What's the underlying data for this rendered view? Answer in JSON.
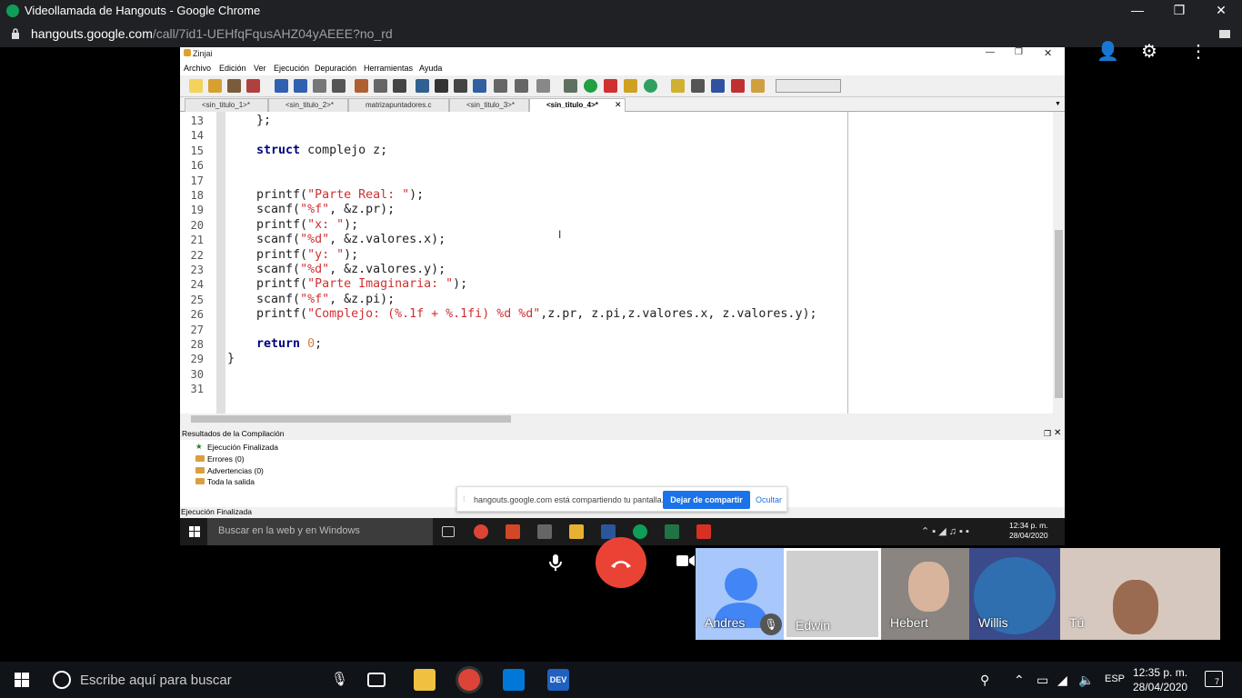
{
  "chrome": {
    "title": "Videollamada de Hangouts - Google Chrome",
    "url_host": "hangouts.google.com",
    "url_path": "/call/7id1-UEHfqFqusAHZ04yAEEE?no_rd",
    "minimize": "—",
    "restore": "❐",
    "close": "✕"
  },
  "zinjai": {
    "title": "Zinjai",
    "menu": [
      "Archivo",
      "Edición",
      "Ver",
      "Ejecución",
      "Depuración",
      "Herramientas",
      "Ayuda"
    ],
    "tabs": [
      "<sin_titulo_1>*",
      "<sin_titulo_2>*",
      "matrizapuntadores.c",
      "<sin_titulo_3>*",
      "<sin_titulo_4>*"
    ],
    "active_tab": 4,
    "tab_close": "✕",
    "line_numbers": [
      "13",
      "14",
      "15",
      "16",
      "17",
      "18",
      "19",
      "20",
      "21",
      "22",
      "23",
      "24",
      "25",
      "26",
      "27",
      "28",
      "29",
      "30",
      "31"
    ],
    "code_lines": [
      [
        {
          "t": "    };",
          "c": ""
        }
      ],
      [
        {
          "t": "",
          "c": ""
        }
      ],
      [
        {
          "t": "    ",
          "c": ""
        },
        {
          "t": "struct",
          "c": "kw"
        },
        {
          "t": " complejo z;",
          "c": ""
        }
      ],
      [
        {
          "t": "",
          "c": ""
        }
      ],
      [
        {
          "t": "",
          "c": ""
        }
      ],
      [
        {
          "t": "    printf(",
          "c": ""
        },
        {
          "t": "\"Parte Real: \"",
          "c": "str"
        },
        {
          "t": ");",
          "c": ""
        }
      ],
      [
        {
          "t": "    scanf(",
          "c": ""
        },
        {
          "t": "\"%f\"",
          "c": "str"
        },
        {
          "t": ", &z.pr);",
          "c": ""
        }
      ],
      [
        {
          "t": "    printf(",
          "c": ""
        },
        {
          "t": "\"x: \"",
          "c": "str"
        },
        {
          "t": ");",
          "c": ""
        }
      ],
      [
        {
          "t": "    scanf(",
          "c": ""
        },
        {
          "t": "\"%d\"",
          "c": "str"
        },
        {
          "t": ", &z.valores.x);",
          "c": ""
        }
      ],
      [
        {
          "t": "    printf(",
          "c": ""
        },
        {
          "t": "\"y: \"",
          "c": "str"
        },
        {
          "t": ");",
          "c": ""
        }
      ],
      [
        {
          "t": "    scanf(",
          "c": ""
        },
        {
          "t": "\"%d\"",
          "c": "str"
        },
        {
          "t": ", &z.valores.y);",
          "c": ""
        }
      ],
      [
        {
          "t": "    printf(",
          "c": ""
        },
        {
          "t": "\"Parte Imaginaria: \"",
          "c": "str"
        },
        {
          "t": ");",
          "c": ""
        }
      ],
      [
        {
          "t": "    scanf(",
          "c": ""
        },
        {
          "t": "\"%f\"",
          "c": "str"
        },
        {
          "t": ", &z.pi);",
          "c": ""
        }
      ],
      [
        {
          "t": "    printf(",
          "c": ""
        },
        {
          "t": "\"Complejo: (%.1f + %.1fi) %d %d\"",
          "c": "str"
        },
        {
          "t": ",z.pr, z.pi,z.valores.x, z.valores.y);",
          "c": ""
        }
      ],
      [
        {
          "t": "",
          "c": ""
        }
      ],
      [
        {
          "t": "    ",
          "c": ""
        },
        {
          "t": "return",
          "c": "kw"
        },
        {
          "t": " ",
          "c": ""
        },
        {
          "t": "0",
          "c": "num"
        },
        {
          "t": ";",
          "c": ""
        }
      ],
      [
        {
          "t": "}",
          "c": ""
        }
      ],
      [
        {
          "t": "",
          "c": ""
        }
      ],
      [
        {
          "t": "",
          "c": ""
        }
      ]
    ],
    "results_header": "Resultados de la Compilación",
    "results": [
      "Ejecución Finalizada",
      "Errores (0)",
      "Advertencias (0)",
      "Toda la salida"
    ],
    "status": "Ejecución Finalizada"
  },
  "share_notice": {
    "message": "hangouts.google.com está compartiendo tu pantalla.",
    "stop_button": "Dejar de compartir",
    "hide_button": "Ocultar"
  },
  "inner_taskbar": {
    "search_placeholder": "Buscar en la web y en Windows",
    "time": "12:34 p. m.",
    "date": "28/04/2020"
  },
  "participants": [
    "Andres",
    "Edwin",
    "Hebert",
    "Willis",
    "Tú"
  ],
  "taskbar": {
    "search_placeholder": "Escribe aquí para buscar",
    "language": "ESP",
    "time": "12:35 p. m.",
    "date": "28/04/2020",
    "notification_count": "7"
  }
}
